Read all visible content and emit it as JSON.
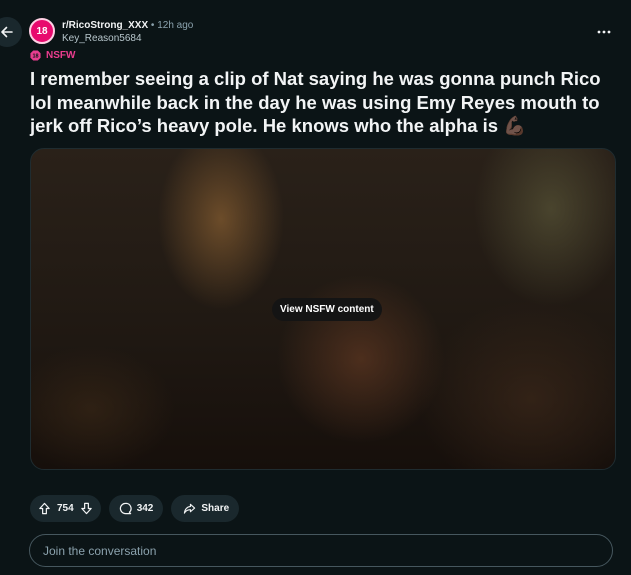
{
  "post": {
    "subreddit": "r/RicoStrong_XXX",
    "subreddit_avatar_text": "18",
    "age": "12h ago",
    "author": "Key_Reason5684",
    "nsfw_label": "NSFW",
    "title": "I remember seeing a clip of Nat saying he was gonna punch Rico lol meanwhile back in the day he was using Emy Reyes mouth to jerk off Rico’s heavy pole. He knows who the alpha is 💪🏿",
    "media": {
      "view_button_label": "View NSFW content"
    },
    "votes": "754",
    "comments": "342",
    "share_label": "Share"
  },
  "comment_box": {
    "placeholder": "Join the conversation"
  },
  "colors": {
    "background": "#0b1416",
    "pill": "#1a282d",
    "nsfw": "#ea3d8f",
    "avatar": "#e80a6e"
  },
  "icons": [
    "back-arrow-icon",
    "more-options-icon",
    "nsfw-badge-icon",
    "upvote-icon",
    "downvote-icon",
    "comment-icon",
    "share-icon"
  ]
}
